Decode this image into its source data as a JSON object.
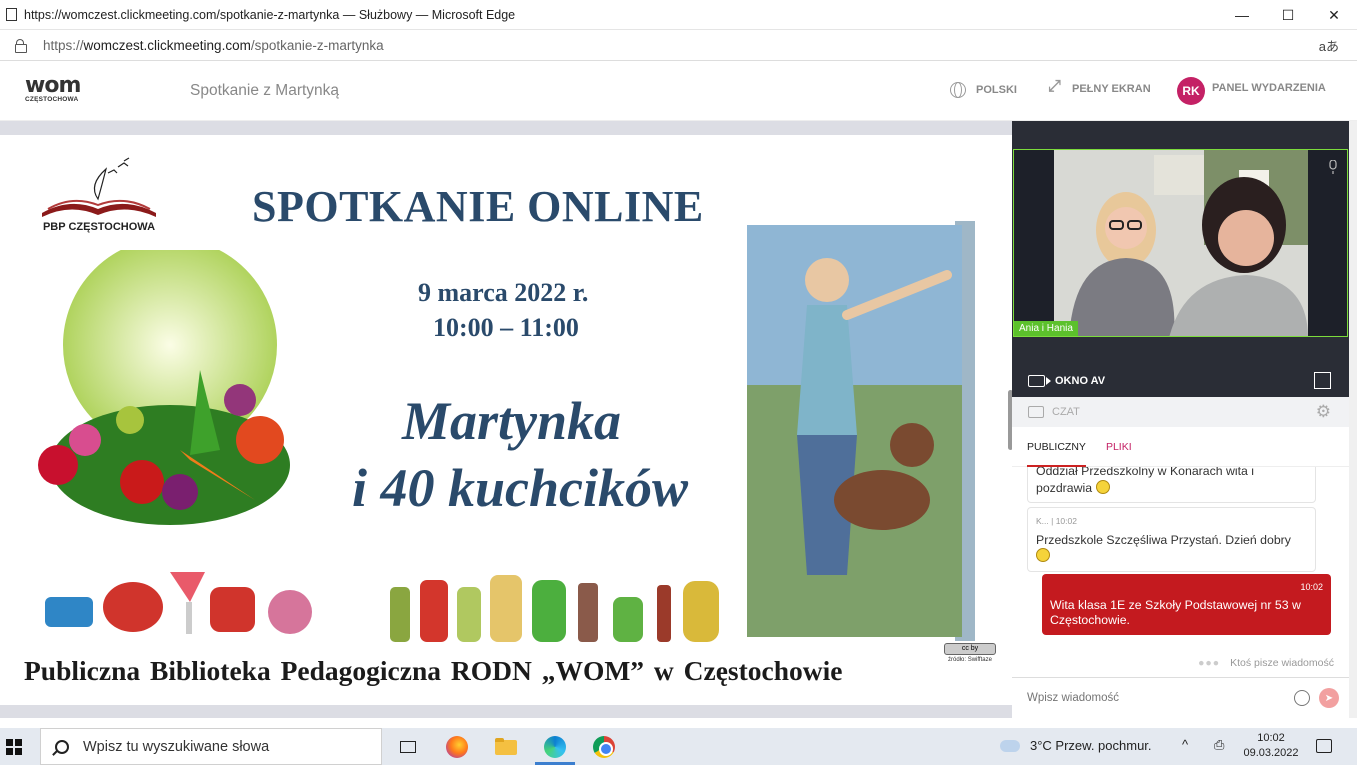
{
  "window": {
    "title": "https://womczest.clickmeeting.com/spotkanie-z-martynka — Służbowy — Microsoft Edge",
    "minimize": "—",
    "maximize": "☐",
    "close": "✕"
  },
  "address_bar": {
    "url_prefix": "https://",
    "url_host": "womczest.clickmeeting.com",
    "url_path": "/spotkanie-z-martynka",
    "read_aloud": "aあ"
  },
  "header": {
    "logo_text": "wom",
    "logo_city": "CZĘSTOCHOWA",
    "event_title": "Spotkanie z Martynką",
    "language": "POLSKI",
    "fullscreen": "PEŁNY EKRAN",
    "avatar_initials": "RK",
    "panel": "PANEL WYDARZENIA",
    "avatar_color": "#c42165"
  },
  "slide": {
    "logo_label": "PBP CZĘSTOCHOWA",
    "headline": "SPOTKANIE ONLINE",
    "date": "9 marca 2022 r.",
    "time": "10:00 – 11:00",
    "book_line1": "Martynka",
    "book_line2": "i 40 kuchcików",
    "footer": "Publiczna Biblioteka Pedagogiczna RODN „WOM”  w Częstochowie",
    "cc_badge": "cc by",
    "cc_source": "źródło: Swifftaze",
    "text_color": "#2a4a6b"
  },
  "av_panel": {
    "participant_name": "Ania i Hania",
    "label": "OKNO AV",
    "active_border": "#7cdc3c"
  },
  "chat": {
    "header": "CZAT",
    "tabs": [
      {
        "label": "PUBLICZNY",
        "active": true
      },
      {
        "label": "PLIKI",
        "active": false
      }
    ],
    "messages": [
      {
        "author": "",
        "time": "",
        "text": "Oddział Przedszkolny w Konarach wita i pozdrawia",
        "emoji": true,
        "own": false
      },
      {
        "author": "K...",
        "time": "10:02",
        "text": "Przedszkole Szczęśliwa Przystań. Dzień dobry",
        "emoji": true,
        "own": false
      },
      {
        "author": "",
        "time": "10:02",
        "text": "Wita klasa 1E ze Szkoły Podstawowej nr 53 w Częstochowie.",
        "emoji": false,
        "own": true
      }
    ],
    "typing": "Ktoś pisze wiadomość",
    "input_placeholder": "Wpisz wiadomość",
    "own_bubble_color": "#c41a1f"
  },
  "taskbar": {
    "search_placeholder": "Wpisz tu wyszukiwane słowa",
    "weather": "3°C  Przew. pochmur.",
    "time": "10:02",
    "date": "09.03.2022",
    "icons": [
      "task-view-icon",
      "firefox-icon",
      "file-explorer-icon",
      "edge-icon",
      "chrome-icon"
    ]
  }
}
